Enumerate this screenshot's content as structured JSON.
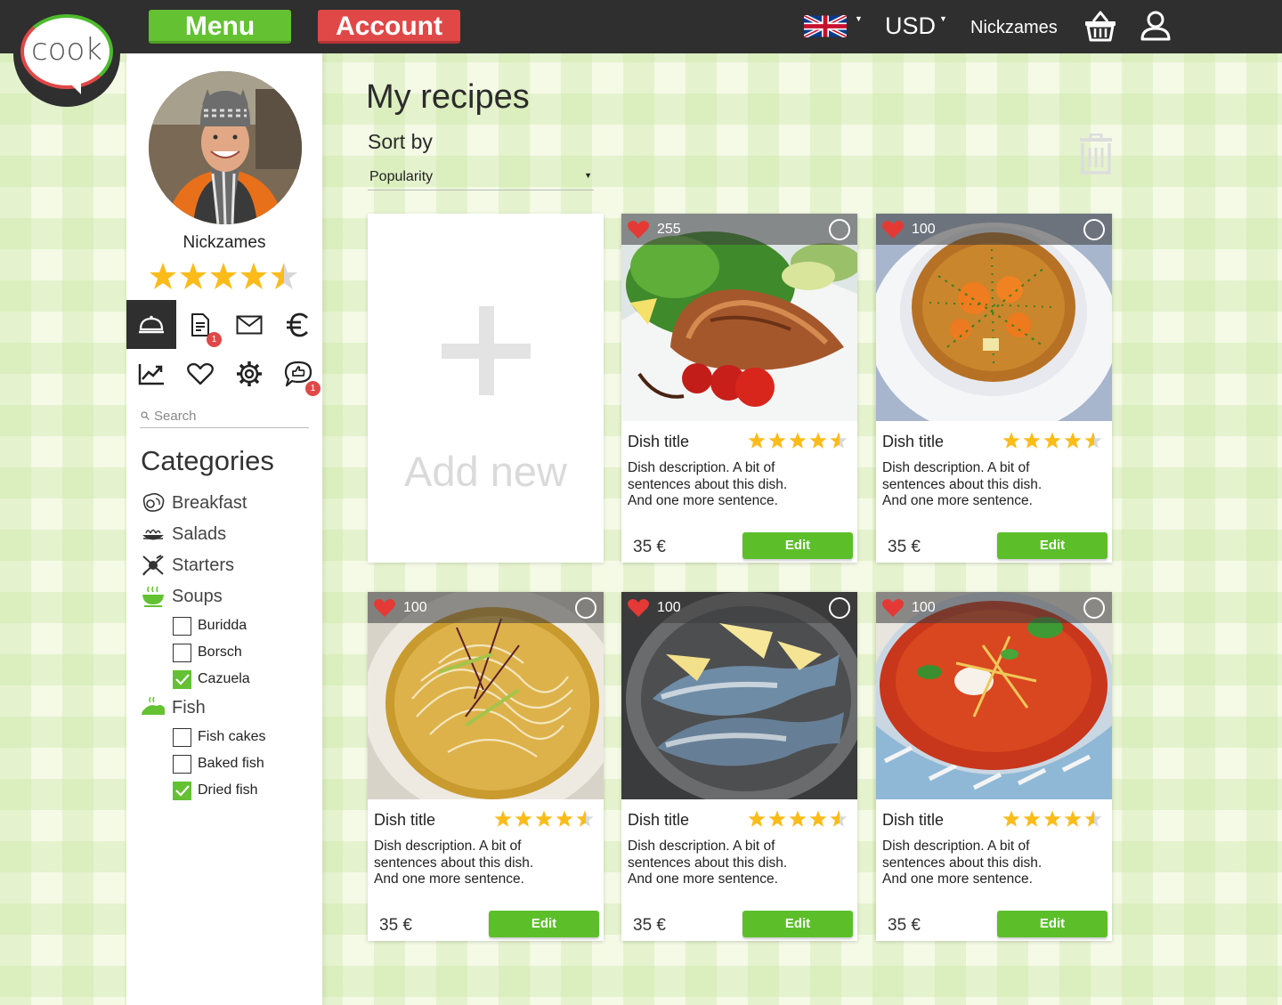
{
  "logo": {
    "text": "cook"
  },
  "topbar": {
    "menu_label": "Menu",
    "account_label": "Account",
    "language_icon": "uk-flag-icon",
    "currency": "USD",
    "username": "Nickzames",
    "cart_icon": "basket-icon",
    "profile_icon": "user-icon"
  },
  "colors": {
    "green": "#63c132",
    "red": "#e04848",
    "topbar": "#2f2f2f",
    "star": "#fbbc1a"
  },
  "sidebar": {
    "username": "Nickzames",
    "rating": 4.5,
    "nav": [
      {
        "icon": "cloche-icon",
        "active": true
      },
      {
        "icon": "document-icon",
        "badge": "1"
      },
      {
        "icon": "mail-icon"
      },
      {
        "icon": "euro-icon"
      },
      {
        "icon": "chart-icon"
      },
      {
        "icon": "heart-icon"
      },
      {
        "icon": "gear-icon"
      },
      {
        "icon": "chat-like-icon",
        "badge": "1"
      }
    ],
    "search_placeholder": "Search",
    "categories_title": "Categories",
    "categories": [
      {
        "label": "Breakfast",
        "icon": "breakfast-icon"
      },
      {
        "label": "Salads",
        "icon": "salad-icon"
      },
      {
        "label": "Starters",
        "icon": "starters-icon"
      },
      {
        "label": "Soups",
        "icon": "soup-icon",
        "active": true,
        "items": [
          {
            "label": "Buridda",
            "checked": false
          },
          {
            "label": "Borsch",
            "checked": false
          },
          {
            "label": "Cazuela",
            "checked": true
          }
        ]
      },
      {
        "label": "Fish",
        "icon": "fish-icon",
        "active": true,
        "items": [
          {
            "label": "Fish cakes",
            "checked": false
          },
          {
            "label": "Baked fish",
            "checked": false
          },
          {
            "label": "Dried fish",
            "checked": true
          }
        ]
      }
    ]
  },
  "main": {
    "title": "My recipes",
    "sort_label": "Sort by",
    "sort_value": "Popularity",
    "add_new_label": "Add new",
    "cards": [
      {
        "likes": "255",
        "photo": "salmon-photo",
        "title": "Dish title",
        "rating": 4.5,
        "desc": [
          "Dish description. A bit of",
          "sentences about this dish.",
          "And one more sentence."
        ],
        "price": "35 €",
        "edit_label": "Edit"
      },
      {
        "likes": "100",
        "photo": "vegetable-soup-photo",
        "title": "Dish title",
        "rating": 4.5,
        "desc": [
          "Dish description. A bit of",
          "sentences about this dish.",
          "And one more sentence."
        ],
        "price": "35 €",
        "edit_label": "Edit"
      },
      {
        "likes": "100",
        "photo": "noodle-soup-photo",
        "title": "Dish title",
        "rating": 4.5,
        "desc": [
          "Dish description. A bit of",
          "sentences about this dish.",
          "And one more sentence."
        ],
        "price": "35 €",
        "edit_label": "Edit"
      },
      {
        "likes": "100",
        "photo": "fried-fish-photo",
        "title": "Dish title",
        "rating": 4.5,
        "desc": [
          "Dish description. A bit of",
          "sentences about this dish.",
          "And one more sentence."
        ],
        "price": "35 €",
        "edit_label": "Edit"
      },
      {
        "likes": "100",
        "photo": "tomato-soup-photo",
        "title": "Dish title",
        "rating": 4.5,
        "desc": [
          "Dish description. A bit of",
          "sentences about this dish.",
          "And one more sentence."
        ],
        "price": "35 €",
        "edit_label": "Edit"
      }
    ]
  }
}
